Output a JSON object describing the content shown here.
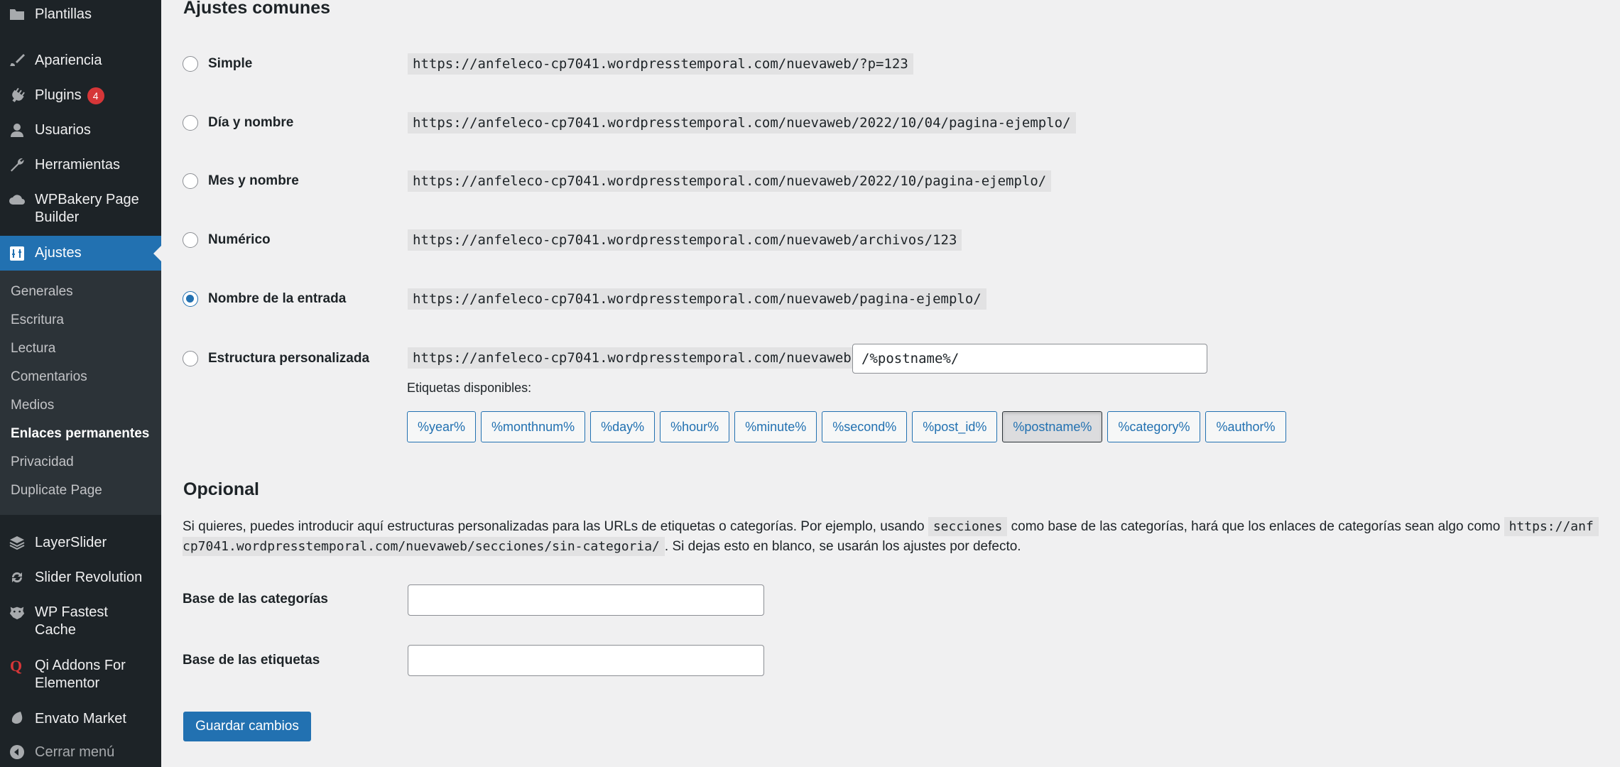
{
  "sidebar": {
    "items": [
      {
        "label": "Plantillas",
        "icon": "folder-icon"
      },
      {
        "label": "Apariencia",
        "icon": "paintbrush-icon"
      },
      {
        "label": "Plugins",
        "icon": "plugin-icon",
        "badge": "4"
      },
      {
        "label": "Usuarios",
        "icon": "user-icon"
      },
      {
        "label": "Herramientas",
        "icon": "wrench-icon"
      },
      {
        "label": "WPBakery Page Builder",
        "icon": "cloud-icon"
      },
      {
        "label": "Ajustes",
        "icon": "settings-icon",
        "active": true
      },
      {
        "label": "LayerSlider",
        "icon": "layers-icon"
      },
      {
        "label": "Slider Revolution",
        "icon": "refresh-icon"
      },
      {
        "label": "WP Fastest Cache",
        "icon": "cheetah-icon"
      },
      {
        "label": "Qi Addons For Elementor",
        "icon": "qi-icon"
      },
      {
        "label": "Envato Market",
        "icon": "leaf-icon"
      },
      {
        "label": "Cerrar menú",
        "icon": "collapse-icon"
      }
    ],
    "submenu": [
      {
        "label": "Generales"
      },
      {
        "label": "Escritura"
      },
      {
        "label": "Lectura"
      },
      {
        "label": "Comentarios"
      },
      {
        "label": "Medios"
      },
      {
        "label": "Enlaces permanentes",
        "current": true
      },
      {
        "label": "Privacidad"
      },
      {
        "label": "Duplicate Page"
      }
    ]
  },
  "common": {
    "heading": "Ajustes comunes",
    "options": [
      {
        "label": "Simple",
        "example": "https://anfeleco-cp7041.wordpresstemporal.com/nuevaweb/?p=123",
        "checked": false
      },
      {
        "label": "Día y nombre",
        "example": "https://anfeleco-cp7041.wordpresstemporal.com/nuevaweb/2022/10/04/pagina-ejemplo/",
        "checked": false
      },
      {
        "label": "Mes y nombre",
        "example": "https://anfeleco-cp7041.wordpresstemporal.com/nuevaweb/2022/10/pagina-ejemplo/",
        "checked": false
      },
      {
        "label": "Numérico",
        "example": "https://anfeleco-cp7041.wordpresstemporal.com/nuevaweb/archivos/123",
        "checked": false
      },
      {
        "label": "Nombre de la entrada",
        "example": "https://anfeleco-cp7041.wordpresstemporal.com/nuevaweb/pagina-ejemplo/",
        "checked": true
      },
      {
        "label": "Estructura personalizada",
        "example": "https://anfeleco-cp7041.wordpresstemporal.com/nuevaweb",
        "checked": false
      }
    ],
    "custom_value": "/%postname%/",
    "tags_label": "Etiquetas disponibles:",
    "tags": [
      "%year%",
      "%monthnum%",
      "%day%",
      "%hour%",
      "%minute%",
      "%second%",
      "%post_id%",
      "%postname%",
      "%category%",
      "%author%"
    ],
    "pressed_tag": "%postname%"
  },
  "optional": {
    "heading": "Opcional",
    "desc_part1": "Si quieres, puedes introducir aquí estructuras personalizadas para las URLs de etiquetas o categorías. Por ejemplo, usando",
    "desc_code1": "secciones",
    "desc_part2": "como base de las categorías, hará que los enlaces de categorías sean algo como",
    "desc_code2a": "https://anf",
    "desc_code2b": "cp7041.wordpresstemporal.com/nuevaweb/secciones/sin-categoria/",
    "desc_part3": ". Si dejas esto en blanco, se usarán los ajustes por defecto.",
    "category_base_label": "Base de las categorías",
    "category_base_value": "",
    "tag_base_label": "Base de las etiquetas",
    "tag_base_value": ""
  },
  "save_label": "Guardar cambios",
  "colors": {
    "accent": "#2271b1",
    "sidebar_bg": "#1d2327",
    "submenu_bg": "#2c3338",
    "badge": "#d63638",
    "page_bg": "#f0f0f1"
  }
}
